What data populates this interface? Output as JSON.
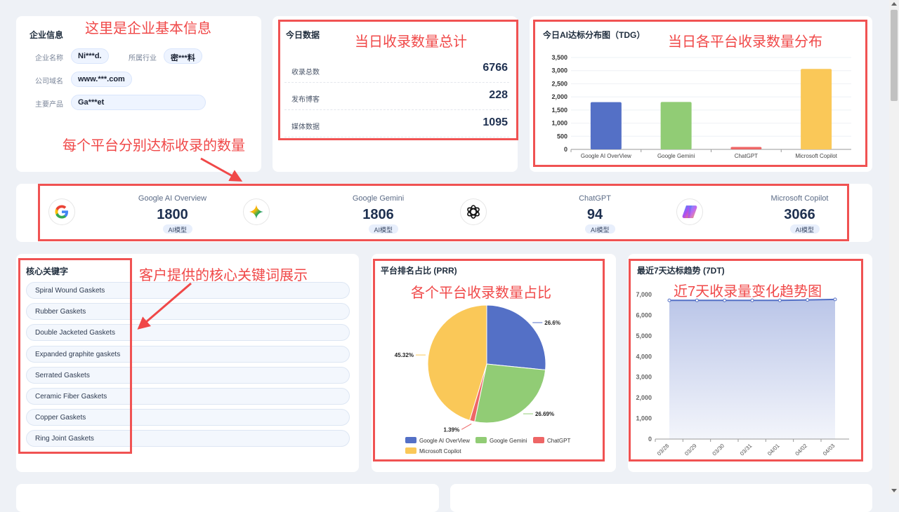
{
  "company": {
    "title": "企业信息",
    "name_label": "企业名称",
    "name": "Ni***d.",
    "industry_label": "所属行业",
    "industry": "密***料",
    "domain_label": "公司域名",
    "domain": "www.***.com",
    "product_label": "主要产品",
    "product": "Ga***et"
  },
  "today": {
    "title": "今日数据",
    "rows": [
      {
        "label": "收录总数",
        "value": "6766"
      },
      {
        "label": "发布博客",
        "value": "228"
      },
      {
        "label": "媒体数据",
        "value": "1095"
      }
    ]
  },
  "platforms": [
    {
      "name": "Google AI Overview",
      "count": "1800",
      "tag": "AI模型",
      "icon": "google-icon"
    },
    {
      "name": "Google Gemini",
      "count": "1806",
      "tag": "AI模型",
      "icon": "gemini-icon"
    },
    {
      "name": "ChatGPT",
      "count": "94",
      "tag": "AI模型",
      "icon": "chatgpt-icon"
    },
    {
      "name": "Microsoft Copilot",
      "count": "3066",
      "tag": "AI模型",
      "icon": "copilot-icon"
    }
  ],
  "keywords": {
    "title": "核心关键字",
    "items": [
      "Spiral Wound Gaskets",
      "Rubber Gaskets",
      "Double Jacketed Gaskets",
      "Expanded graphite gaskets",
      "Serrated Gaskets",
      "Ceramic Fiber Gaskets",
      "Copper Gaskets",
      "Ring Joint Gaskets"
    ]
  },
  "annotations": {
    "company": "这里是企业基本信息",
    "today": "当日收录数量总计",
    "bar": "当日各平台收录数量分布",
    "platforms": "每个平台分别达标收录的数量",
    "keywords": "客户提供的核心关键词展示",
    "pie": "各个平台收录数量占比",
    "trend": "近7天收录量变化趋势图"
  },
  "colors": {
    "blue": "#5470c6",
    "green": "#91cc75",
    "red": "#ee6666",
    "yellow": "#fac858"
  },
  "chart_data": [
    {
      "type": "bar",
      "title": "今日AI达标分布图（TDG）",
      "categories": [
        "Google AI OverView",
        "Google Gemini",
        "ChatGPT",
        "Microsoft Copilot"
      ],
      "values": [
        1800,
        1806,
        94,
        3066
      ],
      "ylim": [
        0,
        3500
      ],
      "yticks": [
        "0",
        "500",
        "1,000",
        "1,500",
        "2,000",
        "2,500",
        "3,000",
        "3,500"
      ]
    },
    {
      "type": "pie",
      "title": "平台排名占比 (PRR)",
      "categories": [
        "Google AI OverView",
        "Google Gemini",
        "ChatGPT",
        "Microsoft Copilot"
      ],
      "values": [
        26.6,
        26.69,
        1.39,
        45.32
      ],
      "labels": [
        "26.6%",
        "26.69%",
        "1.39%",
        "45.32%"
      ],
      "legend": "bottom"
    },
    {
      "type": "area",
      "title": "最近7天达标趋势 (7DT)",
      "x": [
        "03/28",
        "03/29",
        "03/30",
        "03/31",
        "04/01",
        "04/02",
        "04/03"
      ],
      "values": [
        6720,
        6720,
        6720,
        6720,
        6720,
        6740,
        6766
      ],
      "ylim": [
        0,
        7000
      ],
      "yticks": [
        "0",
        "1,000",
        "2,000",
        "3,000",
        "4,000",
        "5,000",
        "6,000",
        "7,000"
      ]
    }
  ]
}
